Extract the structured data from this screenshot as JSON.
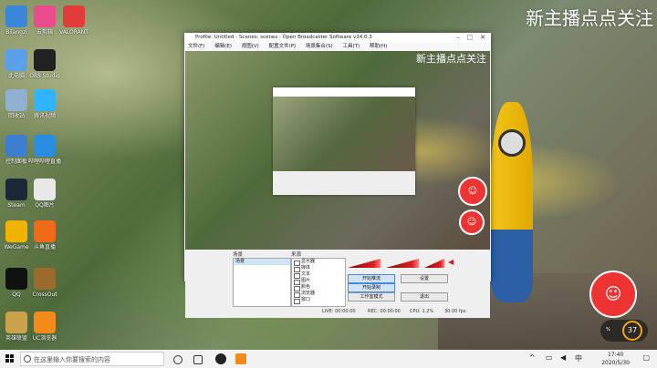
{
  "watermark": "新主播点点关注",
  "desktop_icons": [
    {
      "label": "Bilangzi",
      "color": "#3a86d9"
    },
    {
      "label": "云剪辑",
      "color": "#e94b8c"
    },
    {
      "label": "VALORANT",
      "color": "#e33a3a"
    },
    {
      "label": "此电脑",
      "color": "#5aa0e8"
    },
    {
      "label": "OBS Studio",
      "color": "#222222"
    },
    {
      "label": "回收站",
      "color": "#8fb0d0"
    },
    {
      "label": "腾讯视频",
      "color": "#2fb5ff"
    },
    {
      "label": "控制面板",
      "color": "#3c7fd0"
    },
    {
      "label": "哔哩哔哩直播",
      "color": "#2a8de0"
    },
    {
      "label": "Steam",
      "color": "#1b2838"
    },
    {
      "label": "QQ图片",
      "color": "#e8e8e8"
    },
    {
      "label": "WeGame",
      "color": "#f0b400"
    },
    {
      "label": "斗鱼直播",
      "color": "#f06a1a"
    },
    {
      "label": "QQ",
      "color": "#111111"
    },
    {
      "label": "CrossOut",
      "color": "#9a6b2a"
    },
    {
      "label": "英雄联盟",
      "color": "#c9a24a"
    },
    {
      "label": "UC浏览器",
      "color": "#f38a1a"
    }
  ],
  "obs": {
    "title": "Profile: Untitled - Scenes: scenes - Open Broadcaster Software v24.0.3",
    "menu": [
      "文件(F)",
      "编辑(E)",
      "视图(V)",
      "配置文件(P)",
      "场景集合(S)",
      "工具(T)",
      "帮助(H)"
    ],
    "scenes_title": "场景",
    "scenes": [
      "场景"
    ],
    "sources_title": "来源",
    "sources": [
      "显示器",
      "媒体",
      "文本",
      "图片",
      "颜色",
      "浏览器",
      "窗口"
    ],
    "controls": [
      "开始推流",
      "开始录制",
      "工作室模式",
      "设置",
      "退出"
    ],
    "status": {
      "live": "LIVE: 00:00:00",
      "rec": "REC: 00:00:00",
      "cpu": "CPU: 1.2%",
      "fps": "30.00 fps"
    }
  },
  "fps_overlay": {
    "value": "37",
    "unit": "%"
  },
  "taskbar": {
    "search_placeholder": "在这里输入你要搜索的内容",
    "time": "17:40",
    "date": "2020/5/30"
  }
}
